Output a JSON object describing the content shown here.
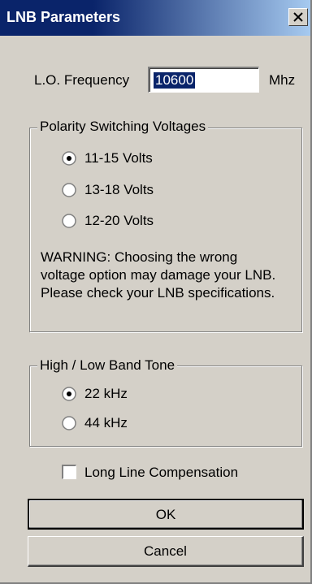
{
  "window": {
    "title": "LNB Parameters",
    "close_glyph": "close-icon"
  },
  "lo_frequency": {
    "label": "L.O. Frequency",
    "value": "10600",
    "unit": "Mhz"
  },
  "polarity": {
    "title": "Polarity Switching Voltages",
    "options": [
      {
        "label": "11-15 Volts",
        "selected": true
      },
      {
        "label": "13-18 Volts",
        "selected": false
      },
      {
        "label": "12-20 Volts",
        "selected": false
      }
    ],
    "warning": "WARNING: Choosing the wrong voltage option may damage your LNB.  Please check your LNB specifications."
  },
  "band_tone": {
    "title": "High / Low Band Tone",
    "options": [
      {
        "label": "22 kHz",
        "selected": true
      },
      {
        "label": "44 kHz",
        "selected": false
      }
    ]
  },
  "long_line": {
    "label": "Long Line Compensation",
    "checked": false
  },
  "buttons": {
    "ok": "OK",
    "cancel": "Cancel"
  },
  "colors": {
    "titlebar_start": "#0a246a",
    "titlebar_end": "#a6caf0",
    "face": "#d4d0c8"
  }
}
